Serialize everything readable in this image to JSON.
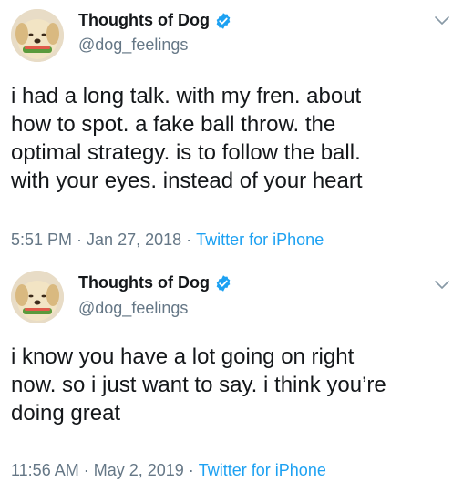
{
  "tweets": [
    {
      "display_name": "Thoughts of Dog",
      "handle": "@dog_feelings",
      "text_lines": [
        "i had a long talk. with my fren. about",
        "how to spot. a fake ball throw. the",
        "optimal strategy. is to follow the ball.",
        "with your eyes. instead of your heart"
      ],
      "time": "5:51 PM",
      "date": "Jan 27, 2018",
      "source": "Twitter for iPhone",
      "separator": "·"
    },
    {
      "display_name": "Thoughts of Dog",
      "handle": "@dog_feelings",
      "text_lines": [
        "i know you have a lot going on right",
        "now. so i just want to say. i think you’re",
        "doing great"
      ],
      "time": "11:56 AM",
      "date": "May 2, 2019",
      "source": "Twitter for iPhone",
      "separator": "·"
    }
  ],
  "icons": {
    "verified": "verified-badge-icon",
    "menu": "chevron-down-icon",
    "avatar": "dog-avatar"
  },
  "colors": {
    "text": "#14171a",
    "muted": "#657786",
    "link": "#1da1f2",
    "verified": "#1da1f2"
  }
}
